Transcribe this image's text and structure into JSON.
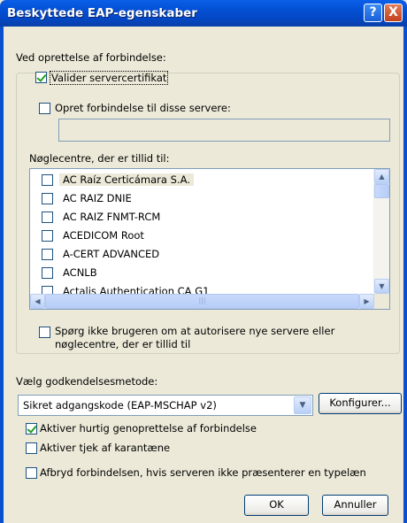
{
  "window": {
    "title": "Beskyttede EAP-egenskaber",
    "help_glyph": "?",
    "close_glyph": "X"
  },
  "connect": {
    "heading": "Ved oprettelse af forbindelse:",
    "validate_cert": {
      "label": "Valider servercertifikat",
      "checked": true
    },
    "connect_servers": {
      "label": "Opret forbindelse til disse servere:",
      "checked": false,
      "value": ""
    },
    "ca_heading": "Nøglecentre, der er tillid til:",
    "ca_list": [
      {
        "label": "AC Raíz Certicámara S.A.",
        "checked": false,
        "selected": true
      },
      {
        "label": "AC RAIZ DNIE",
        "checked": false
      },
      {
        "label": "AC RAIZ FNMT-RCM",
        "checked": false
      },
      {
        "label": "ACEDICOM Root",
        "checked": false
      },
      {
        "label": "A-CERT ADVANCED",
        "checked": false
      },
      {
        "label": "ACNLB",
        "checked": false
      },
      {
        "label": "Actalis Authentication CA G1",
        "checked": false
      }
    ],
    "no_prompt": {
      "line1": "Spørg ikke brugeren om at autorisere nye servere eller",
      "line2": "nøglecentre, der er tillid til",
      "checked": false
    }
  },
  "auth": {
    "heading": "Vælg godkendelsesmetode:",
    "selected_method": "Sikret adgangskode (EAP-MSCHAP v2)",
    "configure_label": "Konfigurer...",
    "fast_reconnect": {
      "label": "Aktiver hurtig genoprettelse af forbindelse",
      "checked": true
    },
    "quarantine": {
      "label": "Aktiver tjek af karantæne",
      "checked": false
    },
    "disconnect": {
      "label": "Afbryd forbindelsen, hvis serveren ikke præsenterer en typelæn",
      "checked": false
    }
  },
  "buttons": {
    "ok": "OK",
    "cancel": "Annuller"
  }
}
